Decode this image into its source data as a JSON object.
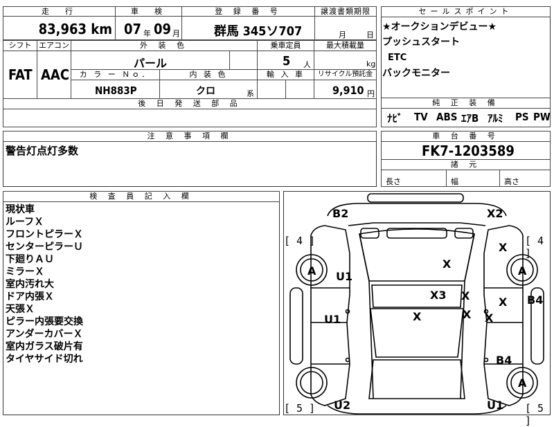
{
  "top": {
    "mileage_header": "走　行",
    "mileage_value": "83,963 km",
    "inspection_header": "車　検",
    "inspection_year": "07",
    "inspection_year_unit": "年",
    "inspection_month": "09",
    "inspection_month_unit": "月",
    "plate_header": "登 録 番 号",
    "plate_value": "群馬 345ソ707",
    "transfer_header": "譲渡書類期限",
    "transfer_month_unit": "月",
    "transfer_day_unit": "日"
  },
  "row2": {
    "shift_header": "シフト",
    "shift_value": "FAT",
    "ac_header": "エアコン",
    "ac_value": "AAC",
    "color_header": "外 装 色",
    "color_value": "パール",
    "capacity_header": "乗車定員",
    "capacity_value": "5",
    "capacity_unit": "人",
    "load_header": "最大積載量",
    "load_unit": "kg",
    "colorno_header": "カ ラ ー Ｎｏ．",
    "colorno_value": "NH883P",
    "interior_header": "内 装 色",
    "interior_value": "クロ",
    "interior_unit": "系",
    "import_header": "輸 入 車",
    "recycle_header": "リサイクル預託金",
    "recycle_value": "9,910",
    "recycle_unit": "円",
    "later_parts_header": "後 日 発 送 部 品"
  },
  "sales": {
    "header": "セールスポイント",
    "lines": [
      "★オークションデビュー★",
      "プッシュスタート",
      "ETC",
      "バックモニター"
    ]
  },
  "equipment": {
    "header": "純 正 装 備",
    "items": [
      "ﾅﾋﾞ",
      "TV",
      "ABS",
      "ｴｱB",
      "ｱﾙﾐ",
      "PS",
      "PW"
    ]
  },
  "notes": {
    "header": "注 意 事 項 欄",
    "text": "警告灯点灯多数"
  },
  "chassis": {
    "header": "車 台 番 号",
    "value": "FK7-1203589",
    "dims_header": "諸 元",
    "length_label": "長さ",
    "width_label": "幅",
    "height_label": "高さ"
  },
  "inspector": {
    "header": "検 査 員 記 入 欄",
    "lines": [
      "現状車",
      "ルーフＸ",
      "フロントピラーＸ",
      "センターピラーＵ",
      "下廻りＡＵ",
      "ミラーＸ",
      "室内汚れ大",
      "ドア内張Ｘ",
      "天張Ｘ",
      "ピラー内張要交換",
      "アンダーカバーＸ",
      "室内ガラス破片有",
      "タイヤサイド切れ"
    ]
  },
  "map": {
    "marks": [
      "B2",
      "X2",
      "[ 4 ]",
      "[ 4 ]",
      "X",
      "A",
      "U1",
      "X",
      "A",
      "B4",
      "X3",
      "X",
      "X",
      "U1",
      "X",
      "X",
      "X",
      "B4",
      "A",
      "[ 5 ]",
      "U2",
      "U1",
      "[ 5 ]"
    ]
  }
}
